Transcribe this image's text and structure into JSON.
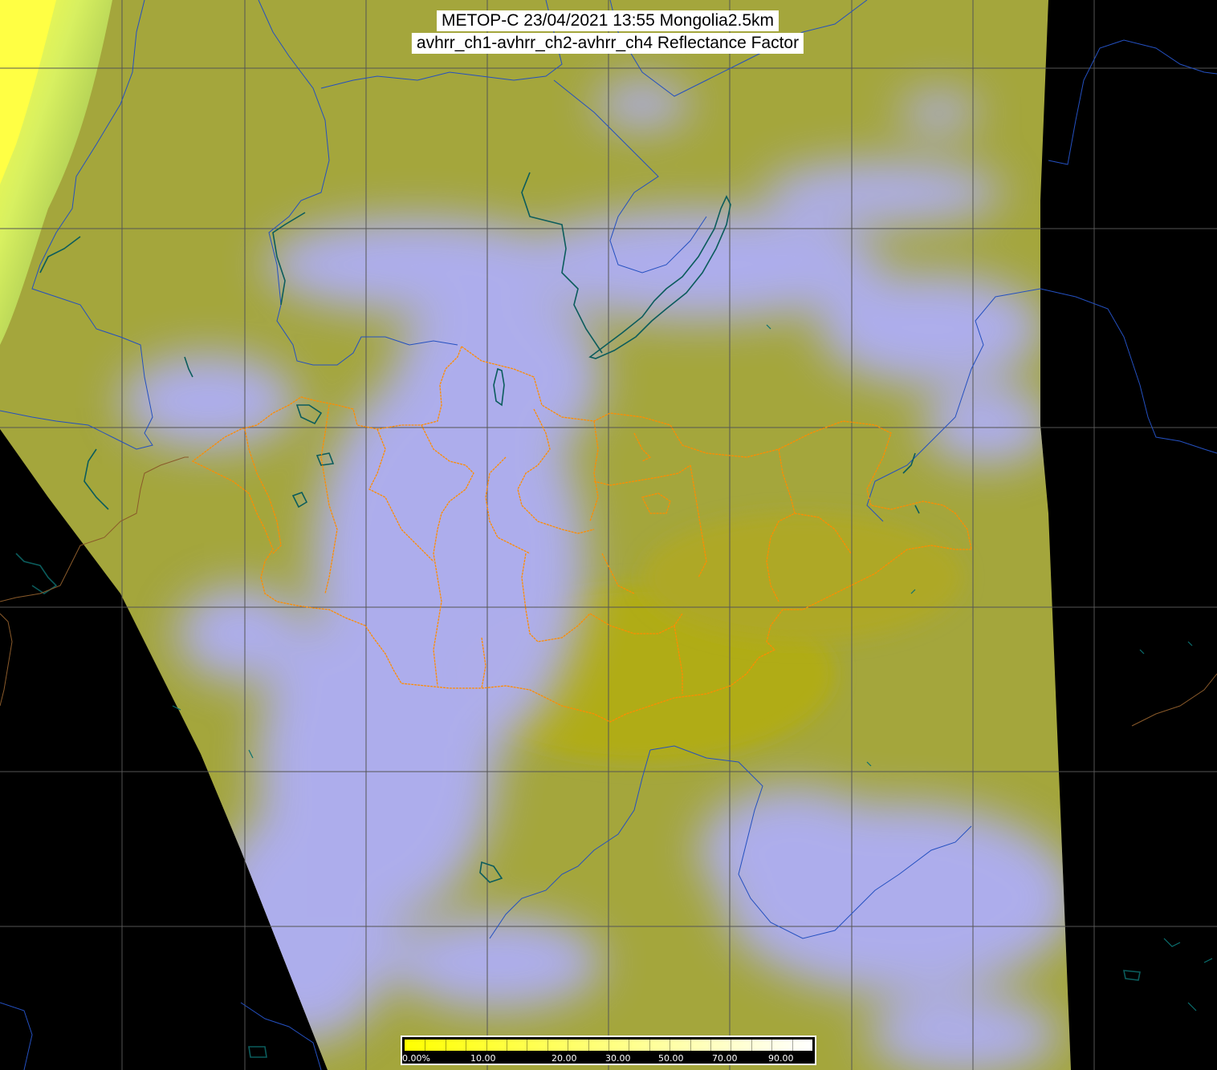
{
  "title": {
    "line1": "METOP-C 23/04/2021 13:55 Mongolia2.5km",
    "line2": "avhrr_ch1-avhrr_ch2-avhrr_ch4 Reflectance Factor"
  },
  "colorbar": {
    "labels": [
      "0.00%",
      "10.00",
      "20.00",
      "30.00",
      "50.00",
      "70.00",
      "90.00"
    ],
    "colors": [
      "#ffff00",
      "#ffff33",
      "#ffff66",
      "#ffff99",
      "#ffffcc",
      "#ffffff"
    ]
  },
  "colors": {
    "background": "#000000",
    "land_clear": "#a4a63c",
    "land_bright": "#b4ac10",
    "cloud": "#a9a8f0",
    "cloud_bright": "#b6b6ff",
    "snow_yellow": "#ffff44",
    "grid": "#555555",
    "coastline": "#1f4fbf",
    "rivers_lakes": "#0b5c5c",
    "mongolia_admin": "#ff8a00",
    "country_border": "#8a5a2a"
  },
  "layers": [
    "graticule",
    "coastline",
    "lakes",
    "rivers",
    "country-borders",
    "mongolia-provinces"
  ]
}
